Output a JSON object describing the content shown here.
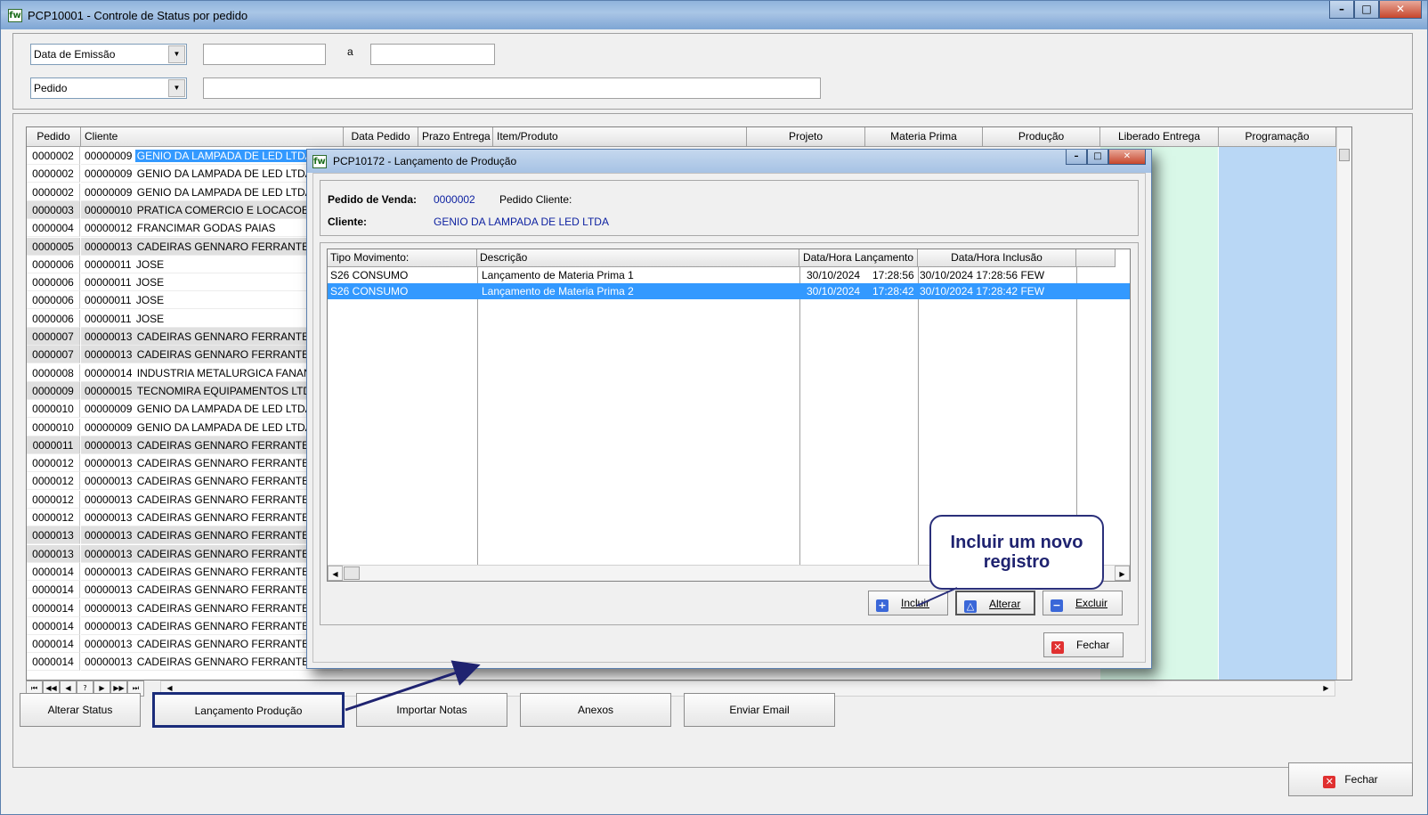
{
  "main_window": {
    "title": "PCP10001 - Controle de Status por pedido",
    "app_icon": "fw",
    "controls": {
      "minimize": "–",
      "maximize": "□",
      "close": "✕"
    }
  },
  "filters": {
    "date_field": {
      "selected": "Data de Emissão",
      "from": "",
      "to": "",
      "range_label": "a"
    },
    "key_field": {
      "selected": "Pedido",
      "value": ""
    }
  },
  "grid": {
    "columns": [
      "Pedido",
      "Cliente",
      "Data Pedido",
      "Prazo Entrega",
      "Item/Produto",
      "Projeto",
      "Materia Prima",
      "Produção",
      "Liberado Entrega",
      "Programação"
    ],
    "rows": [
      {
        "pedido": "0000002",
        "cliente_code": "00000009",
        "cliente_name": "GENIO DA LAMPADA DE LED LTDA",
        "alt": false,
        "sel": true
      },
      {
        "pedido": "0000002",
        "cliente_code": "00000009",
        "cliente_name": "GENIO DA LAMPADA DE LED LTDA",
        "alt": false
      },
      {
        "pedido": "0000002",
        "cliente_code": "00000009",
        "cliente_name": "GENIO DA LAMPADA DE LED LTDA",
        "alt": false
      },
      {
        "pedido": "0000003",
        "cliente_code": "00000010",
        "cliente_name": "PRATICA COMERCIO E LOCACOES LT",
        "alt": true
      },
      {
        "pedido": "0000004",
        "cliente_code": "00000012",
        "cliente_name": "FRANCIMAR GODAS PAIAS",
        "alt": false
      },
      {
        "pedido": "0000005",
        "cliente_code": "00000013",
        "cliente_name": "CADEIRAS GENNARO FERRANTE LT",
        "alt": true
      },
      {
        "pedido": "0000006",
        "cliente_code": "00000011",
        "cliente_name": "JOSE",
        "alt": false
      },
      {
        "pedido": "0000006",
        "cliente_code": "00000011",
        "cliente_name": "JOSE",
        "alt": false
      },
      {
        "pedido": "0000006",
        "cliente_code": "00000011",
        "cliente_name": "JOSE",
        "alt": false
      },
      {
        "pedido": "0000006",
        "cliente_code": "00000011",
        "cliente_name": "JOSE",
        "alt": false
      },
      {
        "pedido": "0000007",
        "cliente_code": "00000013",
        "cliente_name": "CADEIRAS GENNARO FERRANTE LT",
        "alt": true
      },
      {
        "pedido": "0000007",
        "cliente_code": "00000013",
        "cliente_name": "CADEIRAS GENNARO FERRANTE LT",
        "alt": true
      },
      {
        "pedido": "0000008",
        "cliente_code": "00000014",
        "cliente_name": "INDUSTRIA METALURGICA FANANDI",
        "alt": false
      },
      {
        "pedido": "0000009",
        "cliente_code": "00000015",
        "cliente_name": "TECNOMIRA EQUIPAMENTOS LTDA",
        "alt": true
      },
      {
        "pedido": "0000010",
        "cliente_code": "00000009",
        "cliente_name": "GENIO DA LAMPADA DE LED LTDA",
        "alt": false
      },
      {
        "pedido": "0000010",
        "cliente_code": "00000009",
        "cliente_name": "GENIO DA LAMPADA DE LED LTDA",
        "alt": false
      },
      {
        "pedido": "0000011",
        "cliente_code": "00000013",
        "cliente_name": "CADEIRAS GENNARO FERRANTE LT",
        "alt": true
      },
      {
        "pedido": "0000012",
        "cliente_code": "00000013",
        "cliente_name": "CADEIRAS GENNARO FERRANTE LT",
        "alt": false
      },
      {
        "pedido": "0000012",
        "cliente_code": "00000013",
        "cliente_name": "CADEIRAS GENNARO FERRANTE LT",
        "alt": false
      },
      {
        "pedido": "0000012",
        "cliente_code": "00000013",
        "cliente_name": "CADEIRAS GENNARO FERRANTE LT",
        "alt": false
      },
      {
        "pedido": "0000012",
        "cliente_code": "00000013",
        "cliente_name": "CADEIRAS GENNARO FERRANTE LT",
        "alt": false
      },
      {
        "pedido": "0000013",
        "cliente_code": "00000013",
        "cliente_name": "CADEIRAS GENNARO FERRANTE LT",
        "alt": true
      },
      {
        "pedido": "0000013",
        "cliente_code": "00000013",
        "cliente_name": "CADEIRAS GENNARO FERRANTE LT",
        "alt": true
      },
      {
        "pedido": "0000014",
        "cliente_code": "00000013",
        "cliente_name": "CADEIRAS GENNARO FERRANTE LT",
        "alt": false
      },
      {
        "pedido": "0000014",
        "cliente_code": "00000013",
        "cliente_name": "CADEIRAS GENNARO FERRANTE LT",
        "alt": false
      },
      {
        "pedido": "0000014",
        "cliente_code": "00000013",
        "cliente_name": "CADEIRAS GENNARO FERRANTE LT",
        "alt": false
      },
      {
        "pedido": "0000014",
        "cliente_code": "00000013",
        "cliente_name": "CADEIRAS GENNARO FERRANTE LT",
        "alt": false
      },
      {
        "pedido": "0000014",
        "cliente_code": "00000013",
        "cliente_name": "CADEIRAS GENNARO FERRANTE LT",
        "alt": false
      },
      {
        "pedido": "0000014",
        "cliente_code": "00000013",
        "cliente_name": "CADEIRAS GENNARO FERRANTE LT",
        "alt": false
      }
    ],
    "navigator": [
      "⏮",
      "◀◀",
      "◀",
      "?",
      "▶",
      "▶▶",
      "⏭"
    ]
  },
  "actions": {
    "alterar_status": "Alterar Status",
    "lancamento_producao": "Lançamento Produção",
    "importar_notas": "Importar Notas",
    "anexos": "Anexos",
    "enviar_email": "Enviar Email",
    "fechar": "Fechar"
  },
  "dialog": {
    "title": "PCP10172 - Lançamento de Produção",
    "pedido_venda_label": "Pedido de Venda:",
    "pedido_venda_value": "0000002",
    "pedido_cliente_label": "Pedido Cliente:",
    "cliente_label": "Cliente:",
    "cliente_value": "GENIO DA LAMPADA DE LED LTDA",
    "columns": [
      "Tipo Movimento:",
      "Descrição",
      "Data/Hora Lançamento",
      "Data/Hora Inclusão"
    ],
    "rows": [
      {
        "tipo": "S26  CONSUMO",
        "descricao": "Lançamento de Materia Prima 1",
        "lanc_data": "30/10/2024",
        "lanc_hora": "17:28:56",
        "inclusao": "30/10/2024 17:28:56  FEW",
        "selected": false
      },
      {
        "tipo": "S26  CONSUMO",
        "descricao": "Lançamento de Materia Prima 2",
        "lanc_data": "30/10/2024",
        "lanc_hora": "17:28:42",
        "inclusao": "30/10/2024 17:28:42  FEW",
        "selected": true
      }
    ],
    "incluir": "Incluir",
    "alterar": "Alterar",
    "excluir": "Excluir",
    "fechar": "Fechar"
  },
  "callout": {
    "text": "Incluir um novo registro"
  },
  "colors": {
    "selection": "#3399ff",
    "liberado_col": "#d9f8e8",
    "programacao_col": "#b9d7f5",
    "annotation": "#1f2370"
  }
}
